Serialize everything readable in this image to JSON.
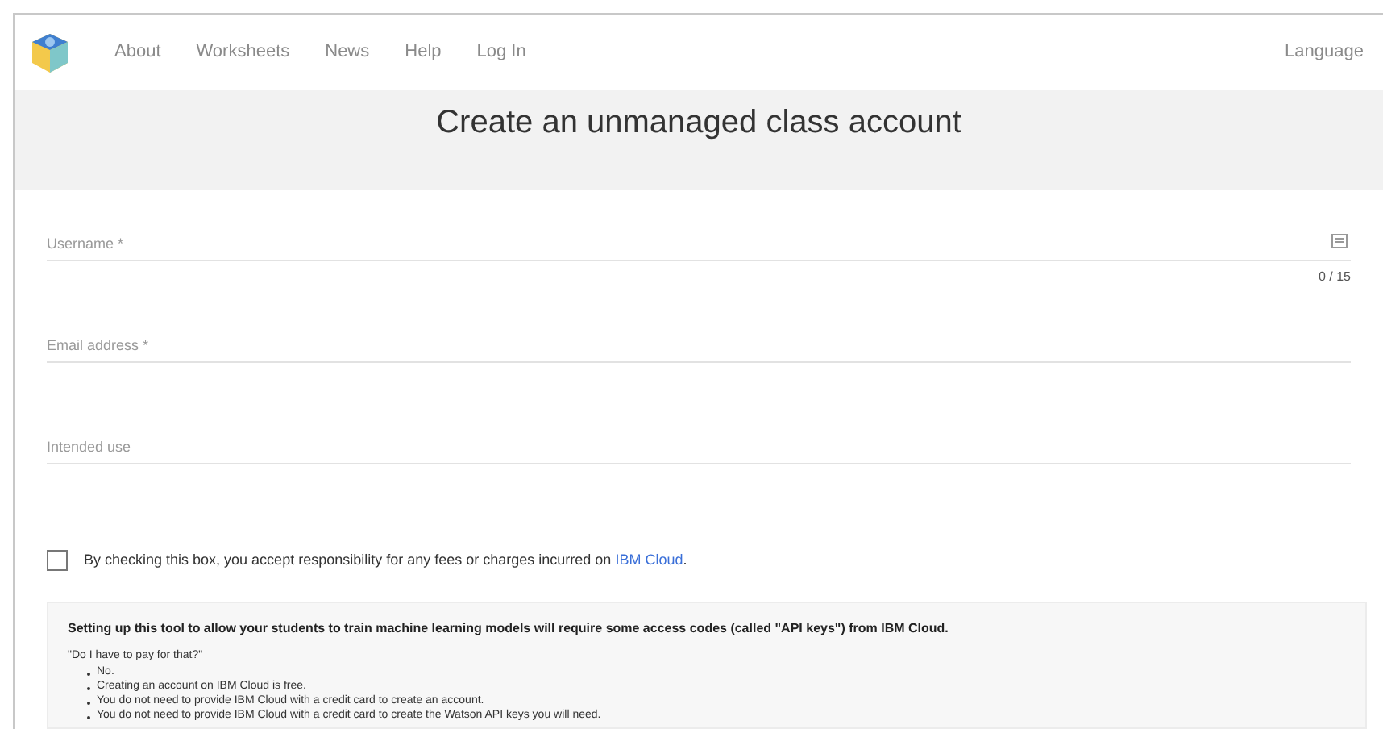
{
  "nav": {
    "items": [
      "About",
      "Worksheets",
      "News",
      "Help",
      "Log In"
    ],
    "language": "Language"
  },
  "title": "Create an unmanaged class account",
  "fields": [
    {
      "label": "Username *",
      "counter": "0 / 15",
      "kind": "counter"
    },
    {
      "label": "Email address *",
      "kind": "plain"
    },
    {
      "label": "Intended use",
      "kind": "plain"
    }
  ],
  "agreement": {
    "checked": false,
    "text": "By checking this box, you accept responsibility for any fees or charges incurred on",
    "link": "IBM Cloud",
    "end": "."
  },
  "info": {
    "heading": "Setting up this tool to allow your students to train machine learning models will require some access codes (called \"API keys\") from IBM Cloud.",
    "question": "\"Do I have to pay for that?\"",
    "bullets": [
      "No.",
      "Creating an account on IBM Cloud is free.",
      "You do not need to provide IBM Cloud with a credit card to create an account.",
      "You do not need to provide IBM Cloud with a credit card to create the Watson API keys you will need."
    ]
  }
}
